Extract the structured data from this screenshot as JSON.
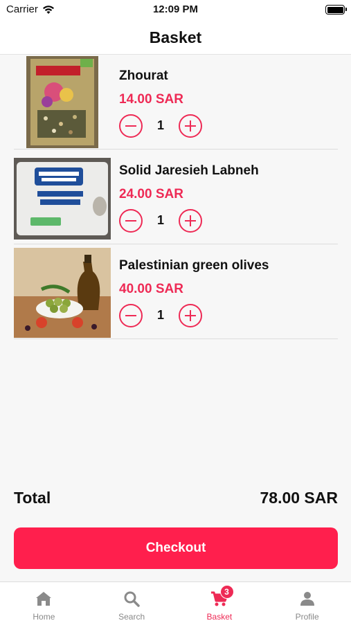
{
  "status_bar": {
    "carrier": "Carrier",
    "time": "12:09 PM"
  },
  "header": {
    "title": "Basket"
  },
  "items": [
    {
      "name": "Zhourat",
      "price": "14.00 SAR",
      "quantity": "1"
    },
    {
      "name": "Solid Jaresieh Labneh",
      "price": "24.00 SAR",
      "quantity": "1"
    },
    {
      "name": "Palestinian green olives",
      "price": "40.00 SAR",
      "quantity": "1"
    }
  ],
  "summary": {
    "total_label": "Total",
    "total_value": "78.00 SAR"
  },
  "checkout": {
    "label": "Checkout"
  },
  "tabbar": {
    "tabs": [
      {
        "label": "Home",
        "icon": "home-icon"
      },
      {
        "label": "Search",
        "icon": "search-icon"
      },
      {
        "label": "Basket",
        "icon": "cart-icon",
        "badge": "3",
        "active": true
      },
      {
        "label": "Profile",
        "icon": "person-icon"
      }
    ]
  },
  "colors": {
    "accent": "#ee2a55",
    "button": "#ff1f4d",
    "inactive": "#888888"
  }
}
